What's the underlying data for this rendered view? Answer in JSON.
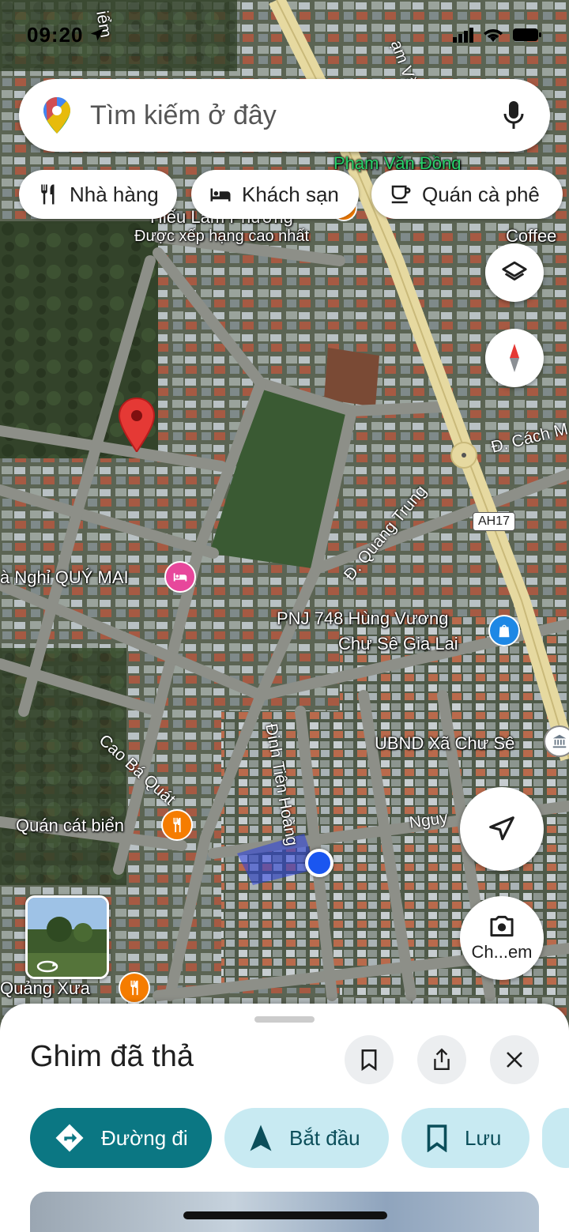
{
  "status_bar": {
    "time": "09:20"
  },
  "search": {
    "placeholder": "Tìm kiếm ở đây"
  },
  "chips": [
    {
      "label": "Nhà hàng",
      "icon": "fork-knife-icon"
    },
    {
      "label": "Khách sạn",
      "icon": "bed-icon"
    },
    {
      "label": "Quán cà phê",
      "icon": "coffee-cup-icon"
    }
  ],
  "map": {
    "labels": {
      "pham_van_dong": "Phạm Văn Đồng",
      "street_top": "ạm Văn Đ",
      "street_top_left": "iểm",
      "hieu_lam": "Hiếu Lâm Phương",
      "top_rated": "Được xếp hạng cao nhất",
      "coffee": "Coffee",
      "cach_mang": "Đ. Cách M",
      "quang_trung": "Đ. Quang Trung",
      "ah17": "AH17",
      "quy_mai": "à Nghỉ QUÝ MAI",
      "pnj_line1": "PNJ 748 Hùng Vương",
      "pnj_line2": "Chư Sê Gia Lai",
      "ubnd": "UBND Xã Chư Sê",
      "cao_ba_quat": "Cao Bá Quát",
      "dinh_tien_hoang": "Đinh Tiên Hoàng",
      "nguy": "Nguy",
      "quan_cat_bien": "Quán cát biển",
      "quang_xua": "Quảng Xưa"
    },
    "street_view_label": "Ch...em",
    "colors": {
      "pin": "#e53935",
      "location_dot": "#1a56f0",
      "hotel_poi": "#e7479b",
      "food_poi": "#f57c00",
      "shop_poi": "#1e88e5"
    }
  },
  "sheet": {
    "title": "Ghim đã thả",
    "actions": [
      {
        "label": "Đường đi",
        "icon": "directions-icon"
      },
      {
        "label": "Bắt đầu",
        "icon": "navigation-arrow-icon"
      },
      {
        "label": "Lưu",
        "icon": "bookmark-icon"
      }
    ]
  }
}
